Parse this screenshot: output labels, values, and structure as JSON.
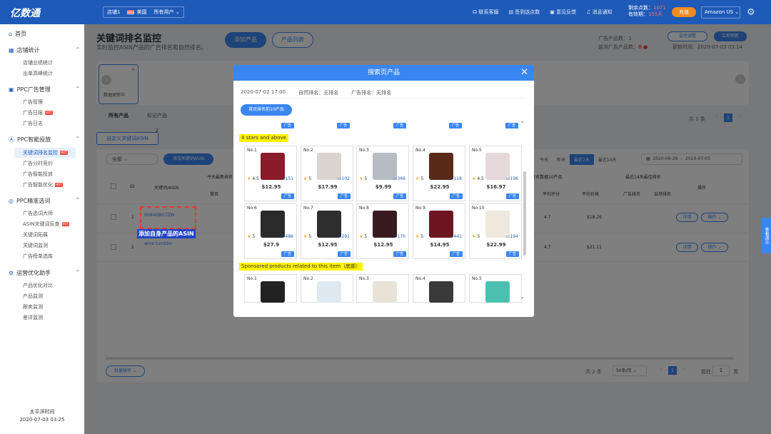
{
  "topbar": {
    "logo": "亿数通",
    "store": "店铺1",
    "country": "美国",
    "user_filter": "所有用户",
    "links": [
      "联系客服",
      "签到送点数",
      "意见反馈",
      "消息通知"
    ],
    "points_label": "剩余点数：",
    "points_value": "1071",
    "valid_label": "有效期：",
    "valid_value": "155天",
    "renew_label": "充值",
    "marketplace": "Amazon US"
  },
  "sidebar": {
    "home": "首页",
    "sections": [
      {
        "label": "店铺统计",
        "items": [
          "店铺业绩统计",
          "出单高峰统计"
        ]
      },
      {
        "label": "PPC广告管理",
        "items": [
          "广告管理",
          "广告日报",
          "广告日志"
        ]
      },
      {
        "label": "PPC智能投放",
        "items": [
          "关键词排名监控",
          "广告分时竞价",
          "广告智能投放",
          "广告智能优化"
        ]
      },
      {
        "label": "PPC精准选词",
        "items": [
          "广告选词大师",
          "ASIN关键词反查",
          "关键词拓展",
          "关键词监测",
          "广告榜单选库"
        ]
      },
      {
        "label": "运营优化助手",
        "items": [
          "产品优化对比",
          "产品监测",
          "跟卖监测",
          "差评监测"
        ]
      }
    ],
    "hot": "HOT",
    "tz_label": "太平洋时间",
    "tz_time": "2020-07-03 03:25"
  },
  "main": {
    "title": "关键词排名监控",
    "subtitle": "实时监控ASIN产品的广告排名和自然排名。",
    "add_product": "添加产品",
    "product_list": "产品列表",
    "ad_count_label": "广告产品数：",
    "ad_count": "1",
    "monitor_label": "监测广告产品数：",
    "monitor_count": "0",
    "update_label": "更新时间：",
    "update_time": "2020-07-03 03:14",
    "monitor_btn": "监控调整",
    "refresh_btn": "立即刷新",
    "card_label": "数据更新中",
    "tabs": [
      "所有产品",
      "标记产品"
    ],
    "total": "共 1 条",
    "page": "1",
    "custom_kw": "自定义关键词ASIN",
    "custom_badge": "2",
    "filter_all": "全部",
    "add_kw": "添加关键词ASIN",
    "range_btns": [
      "今天",
      "昨天",
      "最近7天",
      "最近14天"
    ],
    "date_from": "2020-06-26",
    "date_to": "2020-07-03",
    "headers": [
      "ID",
      "关键词/ASIN",
      "今天最新排名",
      "首页",
      "首页排名数据10产品",
      "平均评分",
      "平均价格",
      "最近14天最佳排名",
      "广告排名",
      "自然排名",
      "操作"
    ],
    "rows": [
      {
        "id": "1",
        "kw": "B084G8G7ZW",
        "rating": "4.7",
        "price": "$18.26",
        "detail": "详情",
        "op": "操作"
      },
      {
        "id": "2",
        "kw": "wine tumbler",
        "rating": "4.7",
        "price": "$21.11",
        "detail": "详情",
        "op": "操作"
      }
    ],
    "bulk": "批量操作",
    "total2": "共 2 条",
    "per_page": "50条/页",
    "goto": "前往",
    "goto_page": "1",
    "page_unit": "页",
    "asin_callout": "添加自身产品的ASIN",
    "help": "查看演示"
  },
  "modal": {
    "title": "搜索页产品",
    "date": "2020-07-02 17:00",
    "natural_label": "自然排名：",
    "natural_value": "无排名",
    "ad_label": "广告排名：",
    "ad_value": "无排名",
    "top_btn": "首页排名前10产品",
    "ad_tag": "广告",
    "section1": "4 stars and above",
    "section2": "Sponsored products related to this item（底部）",
    "products": [
      {
        "no": "No.1",
        "rating": "4.5",
        "reviews": "151",
        "price": "$12.95"
      },
      {
        "no": "No.2",
        "rating": "5",
        "reviews": "102",
        "price": "$17.99"
      },
      {
        "no": "No.3",
        "rating": "5",
        "reviews": "366",
        "price": "$9.99"
      },
      {
        "no": "No.4",
        "rating": "5",
        "reviews": "118",
        "price": "$22.95"
      },
      {
        "no": "No.5",
        "rating": "4.5",
        "reviews": "196",
        "price": "$16.97"
      },
      {
        "no": "No.6",
        "rating": "5",
        "reviews": "486",
        "price": "$27.9"
      },
      {
        "no": "No.7",
        "rating": "5",
        "reviews": "291",
        "price": "$12.95"
      },
      {
        "no": "No.8",
        "rating": "5",
        "reviews": "170",
        "price": "$12.95"
      },
      {
        "no": "No.9",
        "rating": "5",
        "reviews": "441",
        "price": "$14.95"
      },
      {
        "no": "No.10",
        "rating": "5",
        "reviews": "194",
        "price": "$22.99"
      }
    ],
    "sponsored": [
      "No.1",
      "No.2",
      "No.3",
      "No.4",
      "No.5"
    ]
  },
  "colors": {
    "brand": "#1e5ab8",
    "accent": "#3a86f0",
    "highlight": "#fff200",
    "callout": "#e53935"
  }
}
